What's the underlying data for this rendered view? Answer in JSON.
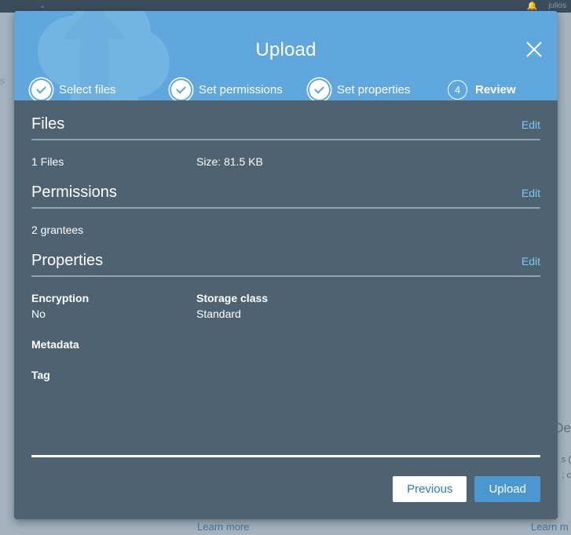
{
  "background": {
    "navbar": {
      "left_glyph": "⌄",
      "bell_icon": "bell-icon",
      "user_label": "julios"
    },
    "learn_more_1": "Learn more",
    "learn_more_2": "Learn m",
    "right_text_a": "De",
    "right_text_b": "s (",
    "right_text_c": "; c",
    "left_sliver": "s"
  },
  "modal": {
    "title": "Upload",
    "close_icon": "close-icon",
    "steps": [
      {
        "label": "Select files",
        "state": "done",
        "badge": "check-icon"
      },
      {
        "label": "Set permissions",
        "state": "done",
        "badge": "check-icon"
      },
      {
        "label": "Set properties",
        "state": "done",
        "badge": "check-icon"
      },
      {
        "label": "Review",
        "state": "current",
        "badge": "4"
      }
    ],
    "sections": [
      {
        "title": "Files",
        "edit_label": "Edit",
        "col_a": "1 Files",
        "col_b": "Size: 81.5 KB"
      },
      {
        "title": "Permissions",
        "edit_label": "Edit",
        "col_a": "2 grantees",
        "col_b": ""
      }
    ],
    "properties": {
      "title": "Properties",
      "edit_label": "Edit",
      "encryption_label": "Encryption",
      "encryption_value": "No",
      "storage_class_label": "Storage class",
      "storage_class_value": "Standard",
      "metadata_label": "Metadata",
      "tag_label": "Tag"
    },
    "footer": {
      "previous_label": "Previous",
      "upload_label": "Upload"
    }
  },
  "colors": {
    "header_blue": "#5fa7dc",
    "body_slate": "#4e6271",
    "page_backdrop": "#a3b2bd",
    "navbar_dark": "#3b4c5c",
    "link_blue": "#7ccaf2",
    "primary_button": "#4a97d2"
  }
}
